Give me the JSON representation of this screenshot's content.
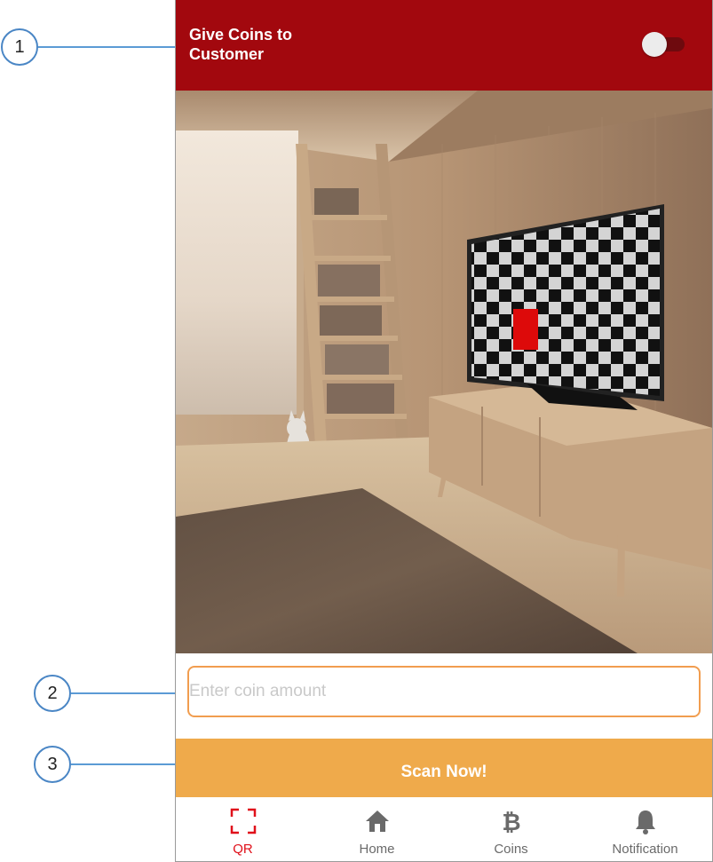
{
  "header": {
    "title": "Give Coins to Customer"
  },
  "toggle": {
    "state": "off"
  },
  "callouts": [
    "1",
    "2",
    "3"
  ],
  "coin_input": {
    "value": "",
    "placeholder": "Enter coin amount"
  },
  "scan_button": {
    "label": "Scan Now!"
  },
  "nav": {
    "items": [
      {
        "label": "QR",
        "icon": "qr-scan-icon",
        "active": true
      },
      {
        "label": "Home",
        "icon": "home-icon",
        "active": false
      },
      {
        "label": "Coins",
        "icon": "bitcoin-icon",
        "active": false
      },
      {
        "label": "Notification",
        "icon": "bell-icon",
        "active": false
      }
    ]
  },
  "colors": {
    "header_bg": "#a2080e",
    "accent_orange": "#efaa4b",
    "input_border": "#f19d4f",
    "active_nav": "#e0101a",
    "callout_blue": "#5b9bd5"
  }
}
